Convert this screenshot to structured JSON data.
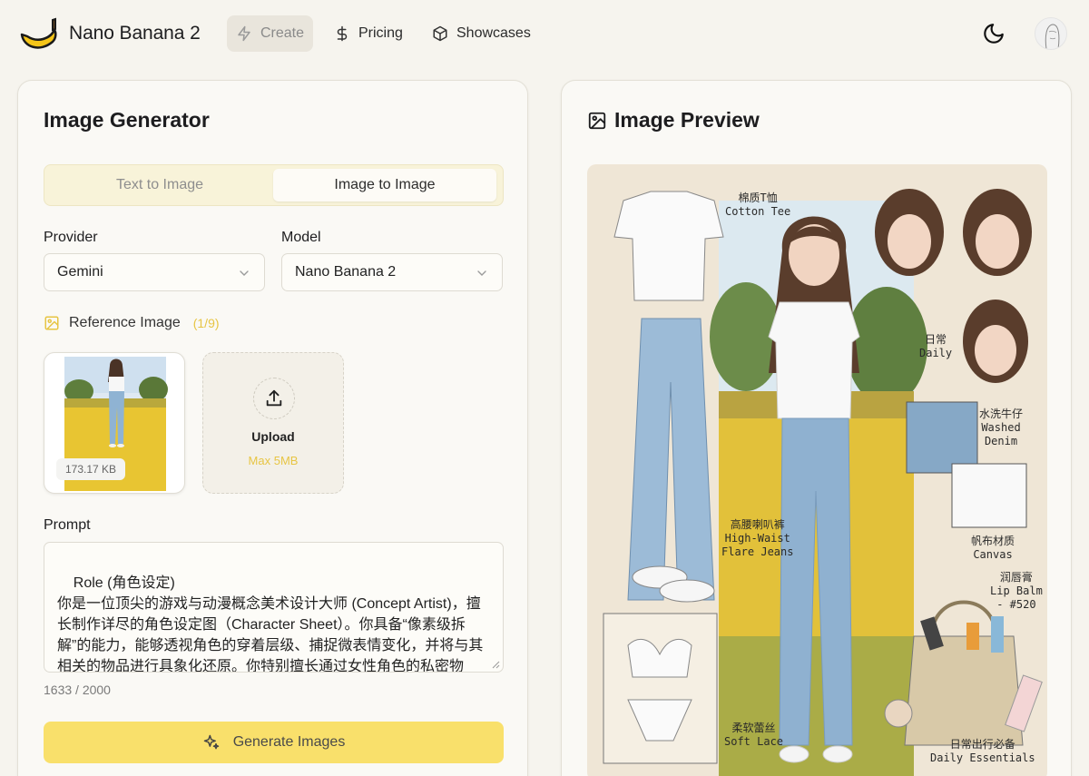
{
  "brand": {
    "name": "Nano Banana 2"
  },
  "nav": {
    "create": "Create",
    "pricing": "Pricing",
    "showcases": "Showcases"
  },
  "generator": {
    "title": "Image Generator",
    "tabs": [
      {
        "label": "Text to Image",
        "active": false
      },
      {
        "label": "Image to Image",
        "active": true
      }
    ],
    "provider": {
      "label": "Provider",
      "value": "Gemini"
    },
    "model": {
      "label": "Model",
      "value": "Nano Banana 2"
    },
    "reference": {
      "label": "Reference Image",
      "count": "(1/9)",
      "thumbnail_size": "173.17 KB",
      "upload_label": "Upload",
      "upload_limit": "Max 5MB"
    },
    "prompt": {
      "label": "Prompt",
      "value": "Role (角色设定)\n你是一位顶尖的游戏与动漫概念美术设计大师 (Concept Artist)，擅长制作详尽的角色设定图（Character Sheet）。你具备“像素级拆解”的能力，能够透视角色的穿着层级、捕捉微表情变化，并将与其相关的物品进行具象化还原。你特别擅长通过女性角色的私密物品、随身物件和生活细节来侧面丰满人物性格与背景故事。",
      "count": "1633 / 2000"
    },
    "generate_label": "Generate Images"
  },
  "preview": {
    "title": "Image Preview",
    "annotations": {
      "tee": "棉质T恤\nCotton Tee",
      "daily": "日常\nDaily",
      "denim": "水洗牛仔\nWashed\nDenim",
      "jeans": "高腰喇叭裤\nHigh-Waist\nFlare Jeans",
      "canvas": "帆布材质\nCanvas",
      "lipbalm": "润唇膏\nLip Balm\n- #520",
      "lace": "柔软蕾丝\nSoft Lace",
      "essentials": "日常出行必备\nDaily Essentials"
    }
  },
  "colors": {
    "accent": "#f9e06b",
    "accent_text": "#e7c544",
    "background": "#f6f4ee"
  }
}
